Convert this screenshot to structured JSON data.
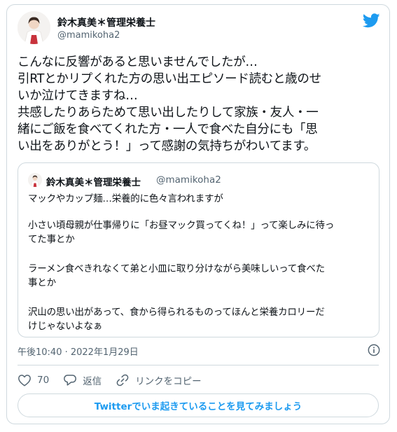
{
  "author": {
    "name": "鈴木真美＊管理栄養士",
    "handle": "@mamikoha2"
  },
  "tweet": {
    "lines": [
      "こんなに反響があると思いませんでしたが…",
      "引RTとかリプくれた方の思い出エピソード読むと歳のせ",
      "いか泣けてきますね…",
      "共感したりあらためて思い出したりして家族・友人・一",
      "緒にご飯を食べてくれた方・一人で食べた自分にも「思",
      "い出をありがとう！」って感謝の気持ちがわいてます。"
    ],
    "timestamp": "午後10:40 · 2022年1月29日"
  },
  "quote": {
    "name": "鈴木真美＊管理栄養士",
    "handle": "@mamikoha2",
    "lines": [
      "マックやカップ麺…栄養的に色々言われますが",
      "小さい頃母親が仕事帰りに「お昼マック買ってくね！」って楽しみに待っ",
      "てた事とか",
      "ラーメン食べきれなくて弟と小皿に取り分けながら美味しいって食べた",
      "事とか",
      "沢山の思い出があって、食から得られるものってほんと栄養カロリーだ",
      "けじゃないよなぁ"
    ]
  },
  "actions": {
    "like_count": "70",
    "reply_label": "返信",
    "copy_link_label": "リンクをコピー"
  },
  "cta": {
    "label": "Twitterでいま起きていることを見てみましょう"
  },
  "icons": {
    "brand": "twitter-bird-icon",
    "info": "info-icon",
    "like": "heart-icon",
    "reply": "reply-bubble-icon",
    "link": "link-icon"
  },
  "colors": {
    "accent": "#1d9bf0",
    "text": "#0f1419",
    "muted": "#536471",
    "border": "#cfd9de"
  }
}
